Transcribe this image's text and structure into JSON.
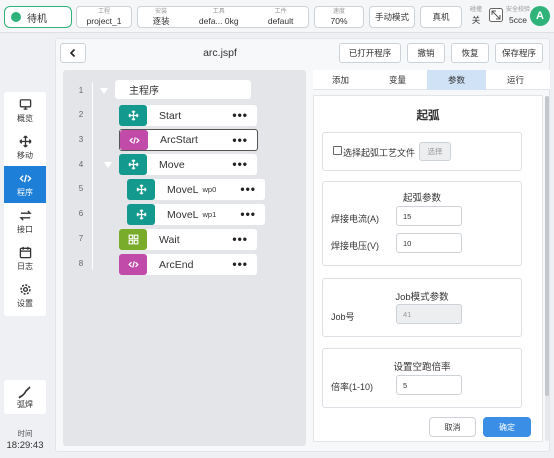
{
  "topbar": {
    "status": "待机",
    "project_label": "工程",
    "project_value": "project_1",
    "install_label": "安装",
    "install_value": "逐装",
    "tool_label": "工具",
    "tool_value": "defa... 0kg",
    "workpiece_label": "工件",
    "workpiece_value": "default",
    "speed_label": "速度",
    "speed_value": "70%",
    "manual_mode": "手动模式",
    "real_machine": "真机",
    "collision_label": "碰撞",
    "collision_value": "关",
    "safety_label": "安全校验",
    "safety_value": "5cce",
    "avatar": "A"
  },
  "sidebar": {
    "items": [
      {
        "label": "概览",
        "icon": "monitor-icon"
      },
      {
        "label": "移动",
        "icon": "move-icon"
      },
      {
        "label": "程序",
        "icon": "code-icon"
      },
      {
        "label": "接口",
        "icon": "swap-icon"
      },
      {
        "label": "日志",
        "icon": "calendar-icon"
      },
      {
        "label": "设置",
        "icon": "gear-icon"
      }
    ],
    "active": "程序",
    "weld_label": "弧焊",
    "time_label": "时间",
    "time_value": "18:29:43"
  },
  "header": {
    "file_name": "arc.jspf",
    "opened_programs": "已打开程序",
    "undo": "撤销",
    "redo": "恢复",
    "save_program": "保存程序"
  },
  "tree": {
    "line_numbers": [
      "1",
      "2",
      "3",
      "4",
      "5",
      "6",
      "7",
      "8"
    ],
    "root": "主程序",
    "nodes": [
      {
        "label": "Start",
        "sub": "",
        "icon": "move-icon",
        "color": "#13998e"
      },
      {
        "label": "ArcStart",
        "sub": "",
        "icon": "code-icon",
        "color": "#c14ba8"
      },
      {
        "label": "Move",
        "sub": "",
        "icon": "move-icon",
        "color": "#13998e"
      },
      {
        "label": "MoveL",
        "sub": "wp0",
        "icon": "move-icon",
        "color": "#13998e"
      },
      {
        "label": "MoveL",
        "sub": "wp1",
        "icon": "move-icon",
        "color": "#13998e"
      },
      {
        "label": "Wait",
        "sub": "",
        "icon": "grid-icon",
        "color": "#7aac2c"
      },
      {
        "label": "ArcEnd",
        "sub": "",
        "icon": "code-icon",
        "color": "#c14ba8"
      }
    ],
    "more": "•••"
  },
  "tabs": [
    {
      "label": "添加"
    },
    {
      "label": "变量"
    },
    {
      "label": "参数"
    },
    {
      "label": "运行"
    }
  ],
  "active_tab": "参数",
  "panel": {
    "title": "起弧",
    "select_file_label": "选择起弧工艺文件",
    "select_button": "选择",
    "arc_params_title": "起弧参数",
    "current_label": "焊接电流(A)",
    "current_value": "15",
    "voltage_label": "焊接电压(V)",
    "voltage_value": "10",
    "job_title": "Job模式参数",
    "job_label": "Job号",
    "job_value": "41",
    "dryrun_title": "设置空跑倍率",
    "ratio_label": "倍率(1-10)",
    "ratio_value": "5",
    "cancel": "取消",
    "confirm": "确定"
  },
  "colors": {
    "accent": "#1e7fd8",
    "status_green": "#2fb37a",
    "teal": "#13998e",
    "magenta": "#c14ba8",
    "olive": "#7aac2c",
    "confirm_blue": "#3a8ee6"
  }
}
